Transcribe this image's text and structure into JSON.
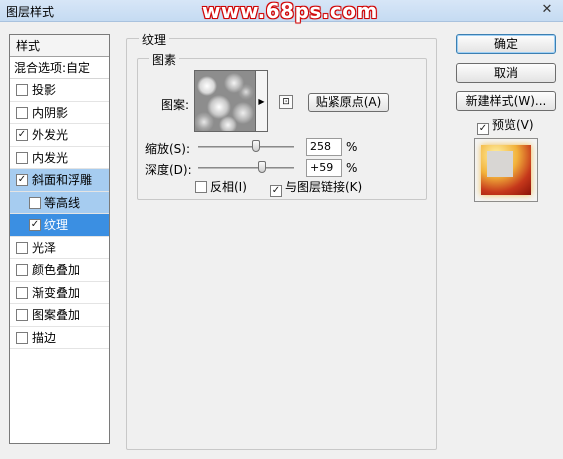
{
  "window": {
    "title": "图层样式",
    "watermark": "www.68ps.com",
    "close_glyph": "✕"
  },
  "style_list": {
    "header": "样式",
    "blend_options": "混合选项:自定",
    "items": [
      {
        "label": "投影",
        "checked": false
      },
      {
        "label": "内阴影",
        "checked": false
      },
      {
        "label": "外发光",
        "checked": true
      },
      {
        "label": "内发光",
        "checked": false
      },
      {
        "label": "斜面和浮雕",
        "checked": true
      },
      {
        "label": "等高线",
        "checked": false
      },
      {
        "label": "纹理",
        "checked": true
      },
      {
        "label": "光泽",
        "checked": false
      },
      {
        "label": "颜色叠加",
        "checked": false
      },
      {
        "label": "渐变叠加",
        "checked": false
      },
      {
        "label": "图案叠加",
        "checked": false
      },
      {
        "label": "描边",
        "checked": false
      }
    ]
  },
  "texture_panel": {
    "section_title": "纹理",
    "group_title": "图素",
    "pattern_label": "图案:",
    "snap_origin_button": "贴紧原点(A)",
    "scale_label": "缩放(S):",
    "scale_value": "258",
    "scale_unit": "%",
    "depth_label": "深度(D):",
    "depth_value": "+59",
    "depth_unit": "%",
    "invert_label": "反相(I)",
    "invert_checked": false,
    "link_label": "与图层链接(K)",
    "link_checked": true,
    "check_glyph": "✓",
    "dropdown_glyph": "▶",
    "new_preset_glyph": "⊡"
  },
  "right_panel": {
    "ok_button": "确定",
    "cancel_button": "取消",
    "new_style_button": "新建样式(W)...",
    "preview_label": "预览(V)",
    "preview_checked": true
  }
}
